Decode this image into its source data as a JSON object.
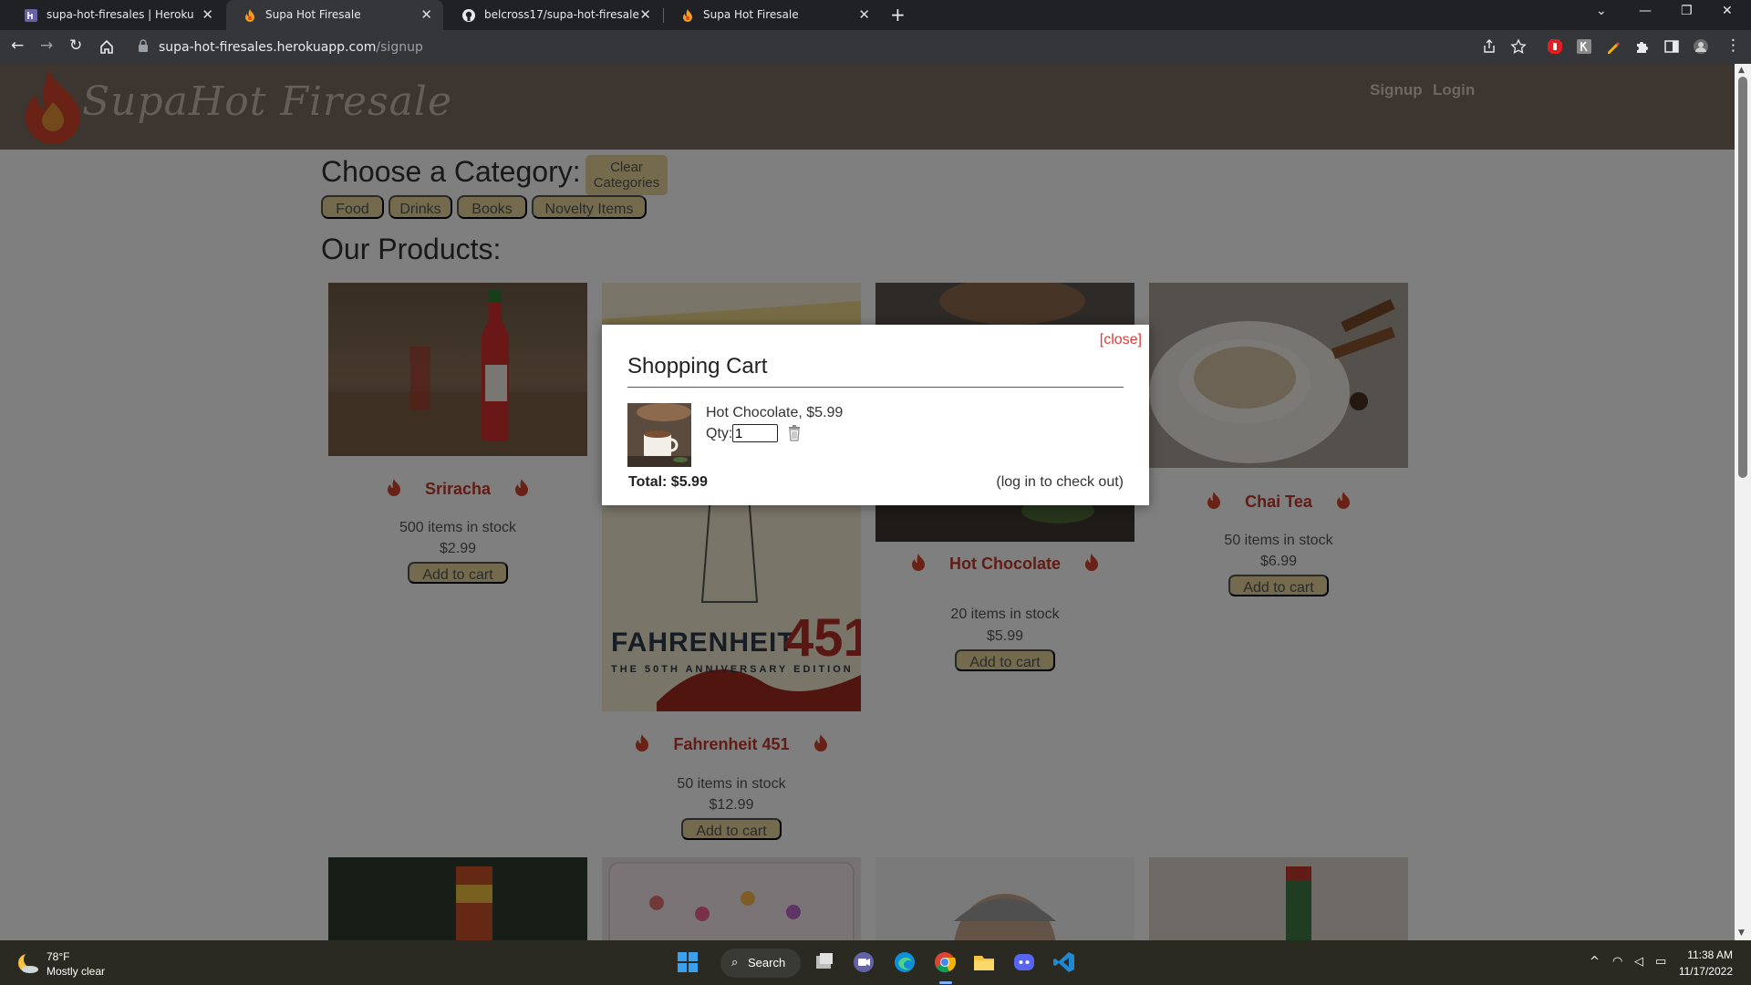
{
  "browser": {
    "tabs": [
      {
        "title": "supa-hot-firesales | Heroku",
        "favicon": "heroku-icon",
        "active": false
      },
      {
        "title": "Supa Hot Firesale",
        "favicon": "flame-icon",
        "active": true
      },
      {
        "title": "belcross17/supa-hot-firesale",
        "favicon": "github-icon",
        "active": false
      },
      {
        "title": "Supa Hot Firesale",
        "favicon": "flame-icon",
        "active": false
      }
    ],
    "url_host": "supa-hot-firesales.herokuapp.com",
    "url_path": "/signup"
  },
  "site": {
    "logo_text": "SupaHot Firesale",
    "nav": {
      "signup": "Signup",
      "login": "Login"
    }
  },
  "categories": {
    "title": "Choose a Category:",
    "clear_label": "Clear Categories",
    "items": [
      "Food",
      "Drinks",
      "Books",
      "Novelty Items"
    ]
  },
  "products_title": "Our Products:",
  "products": [
    {
      "name": "Sriracha",
      "stock": "500 items in stock",
      "price": "$2.99",
      "button": "Add to cart"
    },
    {
      "name": "Fahrenheit 451",
      "stock": "50 items in stock",
      "price": "$12.99",
      "button": "Add to cart"
    },
    {
      "name": "Hot Chocolate",
      "stock": "20 items in stock",
      "price": "$5.99",
      "button": "Add to cart"
    },
    {
      "name": "Chai Tea",
      "stock": "50 items in stock",
      "price": "$6.99",
      "button": "Add to cart"
    }
  ],
  "book_cover": {
    "title": "FAHRENHEIT",
    "number": "451",
    "subtitle": "THE 50TH ANNIVERSARY EDITION"
  },
  "cart": {
    "close_label": "[close]",
    "title": "Shopping Cart",
    "item_text": "Hot Chocolate, $5.99",
    "qty_label": "Qty:",
    "qty_value": "1",
    "total": "Total: $5.99",
    "checkout_note": "(log in to check out)"
  },
  "taskbar": {
    "weather_temp": "78°F",
    "weather_desc": "Mostly clear",
    "search_label": "Search",
    "time": "11:38 AM",
    "date": "11/17/2022"
  },
  "colors": {
    "header_bg": "#7a6a5e",
    "button_bg": "#e8d79f",
    "product_name": "#c0392b",
    "close_red": "#e53935"
  }
}
